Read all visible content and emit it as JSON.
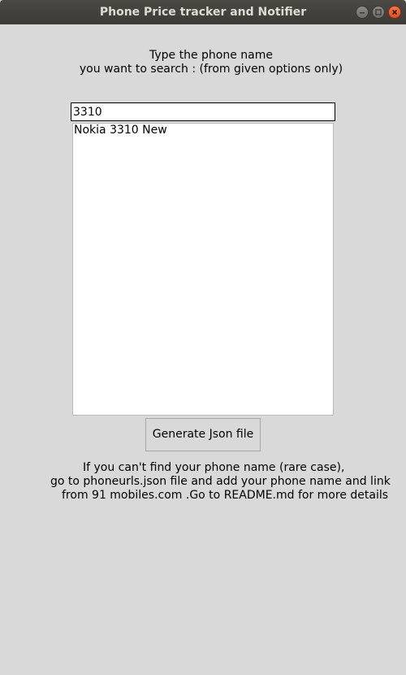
{
  "window": {
    "title": "Phone Price tracker and Notifier"
  },
  "prompt": {
    "line1": "Type the phone name",
    "line2": "you want to search : (from given options only)"
  },
  "search": {
    "value": "3310"
  },
  "results": {
    "items": [
      "Nokia 3310 New"
    ]
  },
  "actions": {
    "generate_label": "Generate Json file"
  },
  "help": {
    "line1": "If you can't find your phone name (rare case),",
    "line2": "go to phoneurls.json file and add your phone name and link",
    "line3": "from 91 mobiles.com .Go to README.md for more details"
  },
  "colors": {
    "background": "#d9d9d9",
    "titlebar": "#3c3b37",
    "close_button": "#e95420"
  }
}
